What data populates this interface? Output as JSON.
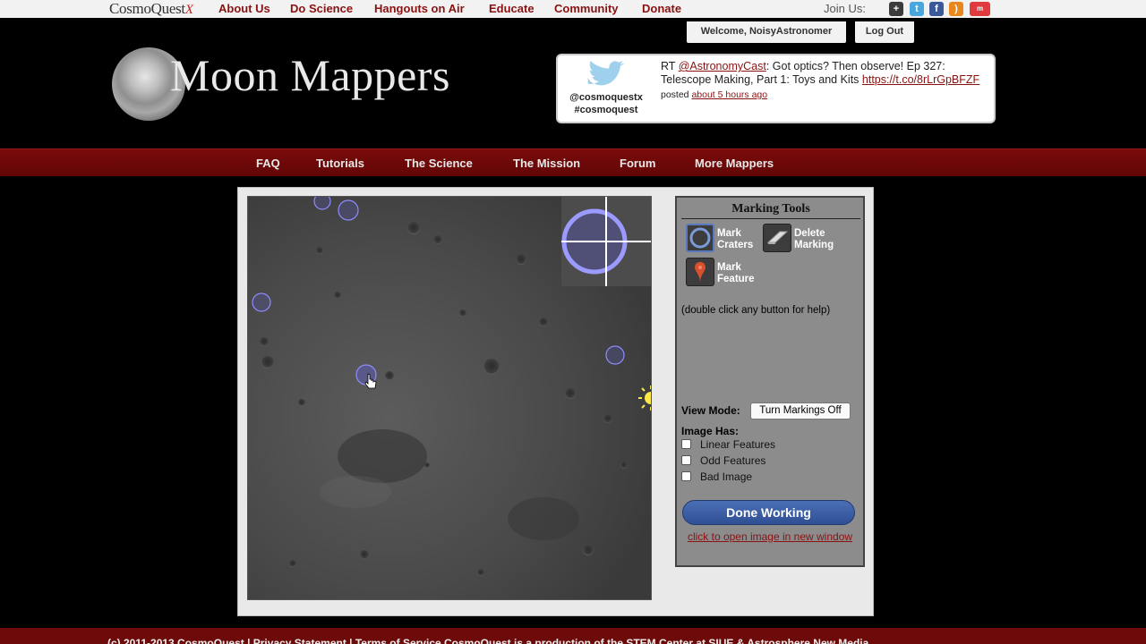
{
  "topbar": {
    "logo": "CosmoQuest",
    "logo_mark": "X",
    "nav": [
      "About Us",
      "Do Science",
      "Hangouts on Air",
      "Educate",
      "Community",
      "Donate"
    ],
    "join_label": "Join Us:",
    "social_icons": [
      "google-plus-icon",
      "twitter-icon",
      "facebook-icon",
      "rss-icon",
      "meetup-icon"
    ]
  },
  "account": {
    "welcome": "Welcome, NoisyAstronomer",
    "logout": "Log Out"
  },
  "header": {
    "title": "Moon Mappers"
  },
  "tweet": {
    "handle_1": "@cosmoquestx",
    "handle_2": "#cosmoquest",
    "prefix": "RT ",
    "mention": "@AstronomyCast",
    "body": ": Got optics? Then observe! Ep 327: Telescope Making, Part 1: Toys and Kits ",
    "link": "https://t.co/8rLrGpBFZF",
    "posted": " posted ",
    "time": "about 5 hours ago"
  },
  "mainnav": [
    "FAQ",
    "Tutorials",
    "The Science",
    "The Mission",
    "Forum",
    "More Mappers"
  ],
  "tools": {
    "title": "Marking Tools",
    "mark_craters": "Mark Craters",
    "delete_marking": "Delete Marking",
    "mark_feature": "Mark Feature",
    "help": "(double click any button for help)",
    "view_mode_label": "View Mode:",
    "toggle_button": "Turn Markings Off",
    "image_has_label": "Image Has:",
    "checkboxes": [
      {
        "label": "Linear Features",
        "checked": false
      },
      {
        "label": "Odd Features",
        "checked": false
      },
      {
        "label": "Bad Image",
        "checked": false
      }
    ],
    "done_button": "Done Working",
    "open_link": "click to open image in new window"
  },
  "colors": {
    "nav_red": "#8a1212",
    "band_red": "#6d0a0a",
    "crater_marker": "#8c8cff",
    "done_blue": "#3a5ba3"
  },
  "footer": {
    "text": "(c) 2011-2013 CosmoQuest | Privacy Statement | Terms of Service      CosmoQuest is a production of the STEM Center at SIUE & Astrosphere New Media"
  }
}
